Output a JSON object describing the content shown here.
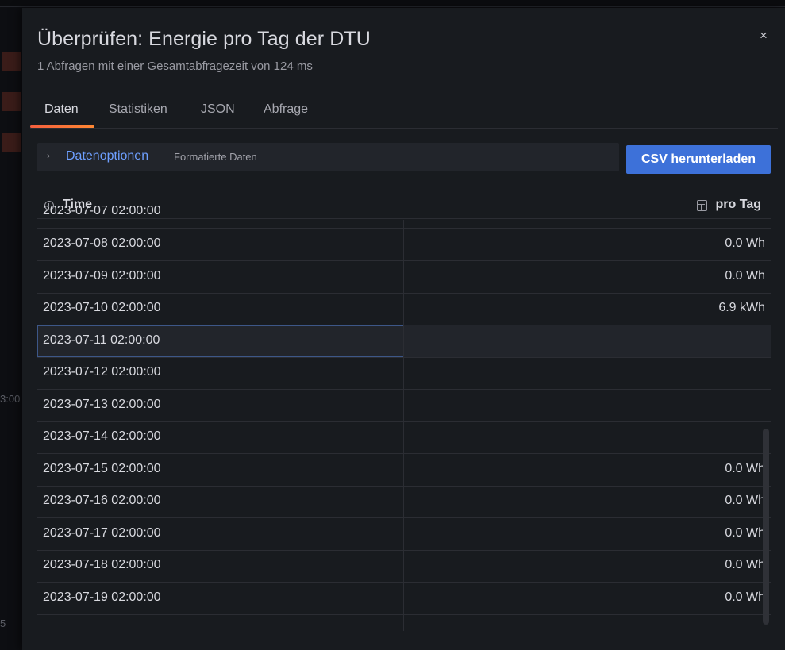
{
  "background": {
    "axis_label_1": "3:00",
    "axis_label_2": "5"
  },
  "drawer": {
    "title": "Überprüfen: Energie pro Tag der DTU",
    "subtitle": "1 Abfragen mit einer Gesamtabfragezeit von 124 ms",
    "close_icon": "×",
    "tabs": [
      {
        "label": "Daten",
        "active": true
      },
      {
        "label": "Statistiken",
        "active": false
      },
      {
        "label": "JSON",
        "active": false
      },
      {
        "label": "Abfrage",
        "active": false
      }
    ],
    "options": {
      "chevron_icon": "›",
      "label": "Datenoptionen",
      "description": "Formatierte Daten"
    },
    "csv_button": "CSV herunterladen",
    "table": {
      "columns": [
        {
          "label": "Time",
          "icon": "clock-icon"
        },
        {
          "label": "pro Tag",
          "icon": "calculator-icon"
        }
      ],
      "rows": [
        {
          "time": "2023-07-07 02:00:00",
          "value": ""
        },
        {
          "time": "2023-07-08 02:00:00",
          "value": "0.0 Wh"
        },
        {
          "time": "2023-07-09 02:00:00",
          "value": "0.0 Wh"
        },
        {
          "time": "2023-07-10 02:00:00",
          "value": "6.9 kWh"
        },
        {
          "time": "2023-07-11 02:00:00",
          "value": ""
        },
        {
          "time": "2023-07-12 02:00:00",
          "value": ""
        },
        {
          "time": "2023-07-13 02:00:00",
          "value": ""
        },
        {
          "time": "2023-07-14 02:00:00",
          "value": ""
        },
        {
          "time": "2023-07-15 02:00:00",
          "value": "0.0 Wh"
        },
        {
          "time": "2023-07-16 02:00:00",
          "value": "0.0 Wh"
        },
        {
          "time": "2023-07-17 02:00:00",
          "value": "0.0 Wh"
        },
        {
          "time": "2023-07-18 02:00:00",
          "value": "0.0 Wh"
        },
        {
          "time": "2023-07-19 02:00:00",
          "value": "0.0 Wh"
        }
      ]
    }
  }
}
